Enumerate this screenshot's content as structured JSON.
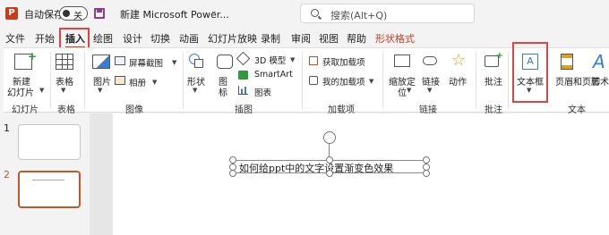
{
  "titlebar": {
    "app_icon": "P",
    "autosave_label": "自动保存",
    "toggle_label": "关",
    "doc_title": "新建 Microsoft Power...",
    "doc_chevron": "⌄",
    "search_placeholder": "搜索(Alt+Q)"
  },
  "tabs": [
    "文件",
    "开始",
    "插入",
    "绘图",
    "设计",
    "切换",
    "动画",
    "幻灯片放映",
    "录制",
    "审阅",
    "视图",
    "帮助",
    "形状格式"
  ],
  "ribbon": {
    "new_slide": "新建",
    "new_slide2": "幻灯片",
    "table": "表格",
    "image": "图片",
    "screenshot": "屏幕截图",
    "album": "相册",
    "shapes": "形状",
    "icons": "图",
    "icons2": "标",
    "model3d": "3D 模型",
    "smartart": "SmartArt",
    "chart": "图表",
    "get_addins": "获取加载项",
    "my_addins": "我的加载项",
    "zoom": "缩放定",
    "zoom2": "位",
    "link": "链接",
    "action": "动作",
    "comment": "批注",
    "textbox": "文本框",
    "header_footer": "页眉和页脚",
    "wordart": "艺术字",
    "groups": {
      "slides": "幻灯片",
      "tables": "表格",
      "images": "图像",
      "illustrations": "插图",
      "addins": "加载项",
      "links": "链接",
      "comments": "批注",
      "text": "文本"
    }
  },
  "thumbnails": [
    {
      "num": "1"
    },
    {
      "num": "2"
    }
  ],
  "slide": {
    "textbox_text": "如何给ppt中的文字设置渐变色效果"
  },
  "colors": {
    "accent": "#c43e1c",
    "highlight_box": "#e04444",
    "context_tab": "#c43e1c",
    "selected_thumb": "#c4562b"
  }
}
